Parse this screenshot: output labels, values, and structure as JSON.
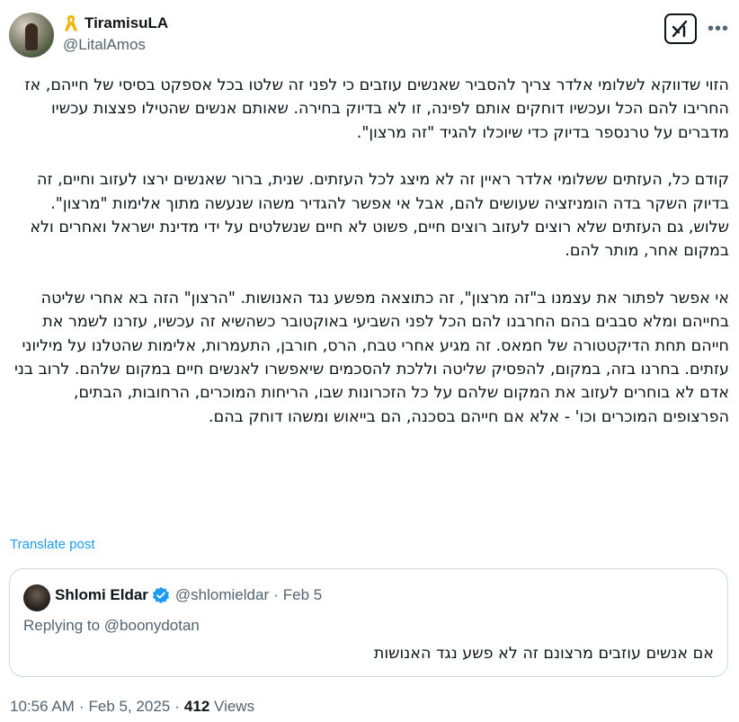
{
  "author": {
    "display_name": "TiramisuLA",
    "handle": "@LitalAmos",
    "badge_icon": "yellow-ribbon-icon",
    "badge_color": "#f4b400"
  },
  "actions": {
    "grok_icon": "grok-icon",
    "more_icon": "more-icon",
    "more_label": "•••"
  },
  "post": {
    "paragraphs": [
      "הזוי שדווקא לשלומי אלדר צריך להסביר שאנשים עוזבים כי לפני זה שלטו בכל אספקט בסיסי של חייהם, אז החריבו להם הכל ועכשיו דוחקים אותם לפינה, זו לא בדיוק בחירה. שאותם אנשים שהטילו פצצות עכשיו מדברים על טרנספר בדיוק כדי שיוכלו להגיד \"זה מרצון\".",
      "קודם כל, העזתים ששלומי אלדר ראיין זה לא מיצג לכל העזתים. שנית, ברור שאנשים ירצו לעזוב וחיים, זה בדיוק השקר בדה הומניזציה שעושים להם, אבל אי אפשר להגדיר משהו שנעשה מתוך אלימות \"מרצון\". שלוש, גם העזתים שלא רוצים לעזוב רוצים חיים, פשוט לא חיים שנשלטים על ידי מדינת ישראל ואחרים ולא במקום אחר, מותר להם.",
      "אי אפשר לפתור את עצמנו ב\"זה מרצון\", זה כתוצאה מפשע נגד האנושות. \"הרצון\" הזה בא אחרי שליטה בחייהם ומלא סבבים בהם החרבנו להם הכל לפני השביעי באוקטובר כשהשיא זה עכשיו, עזרנו לשמר את חייהם תחת הדיקטטורה של חמאס. זה מגיע אחרי טבח, הרס, חורבן, התעמרות, אלימות שהטלנו על מיליוני עזתים. בחרנו בזה, במקום, להפסיק שליטה וללכת להסכמים שיאפשרו לאנשים חיים במקום שלהם. לרוב בני אדם לא בוחרים לעזוב את המקום שלהם על כל הזכרונות שבו, הריחות המוכרים, הרחובות, הבתים, הפרצופים המוכרים וכו' - אלא אם חייהם בסכנה, הם בייאוש ומשהו דוחק בהם."
    ],
    "translate_label": "Translate post"
  },
  "quote": {
    "display_name": "Shlomi Eldar",
    "verified_icon": "verified-badge-icon",
    "verified_color": "#1d9bf0",
    "handle": "@shlomieldar",
    "separator": "·",
    "date": "Feb 5",
    "replying_to": "Replying to @boonydotan",
    "text": "אם אנשים עוזבים מרצונם זה לא פשע נגד האנושות"
  },
  "meta": {
    "time": "10:56 AM",
    "separator": "·",
    "date": "Feb 5, 2025",
    "views_count": "412",
    "views_label": "Views"
  }
}
